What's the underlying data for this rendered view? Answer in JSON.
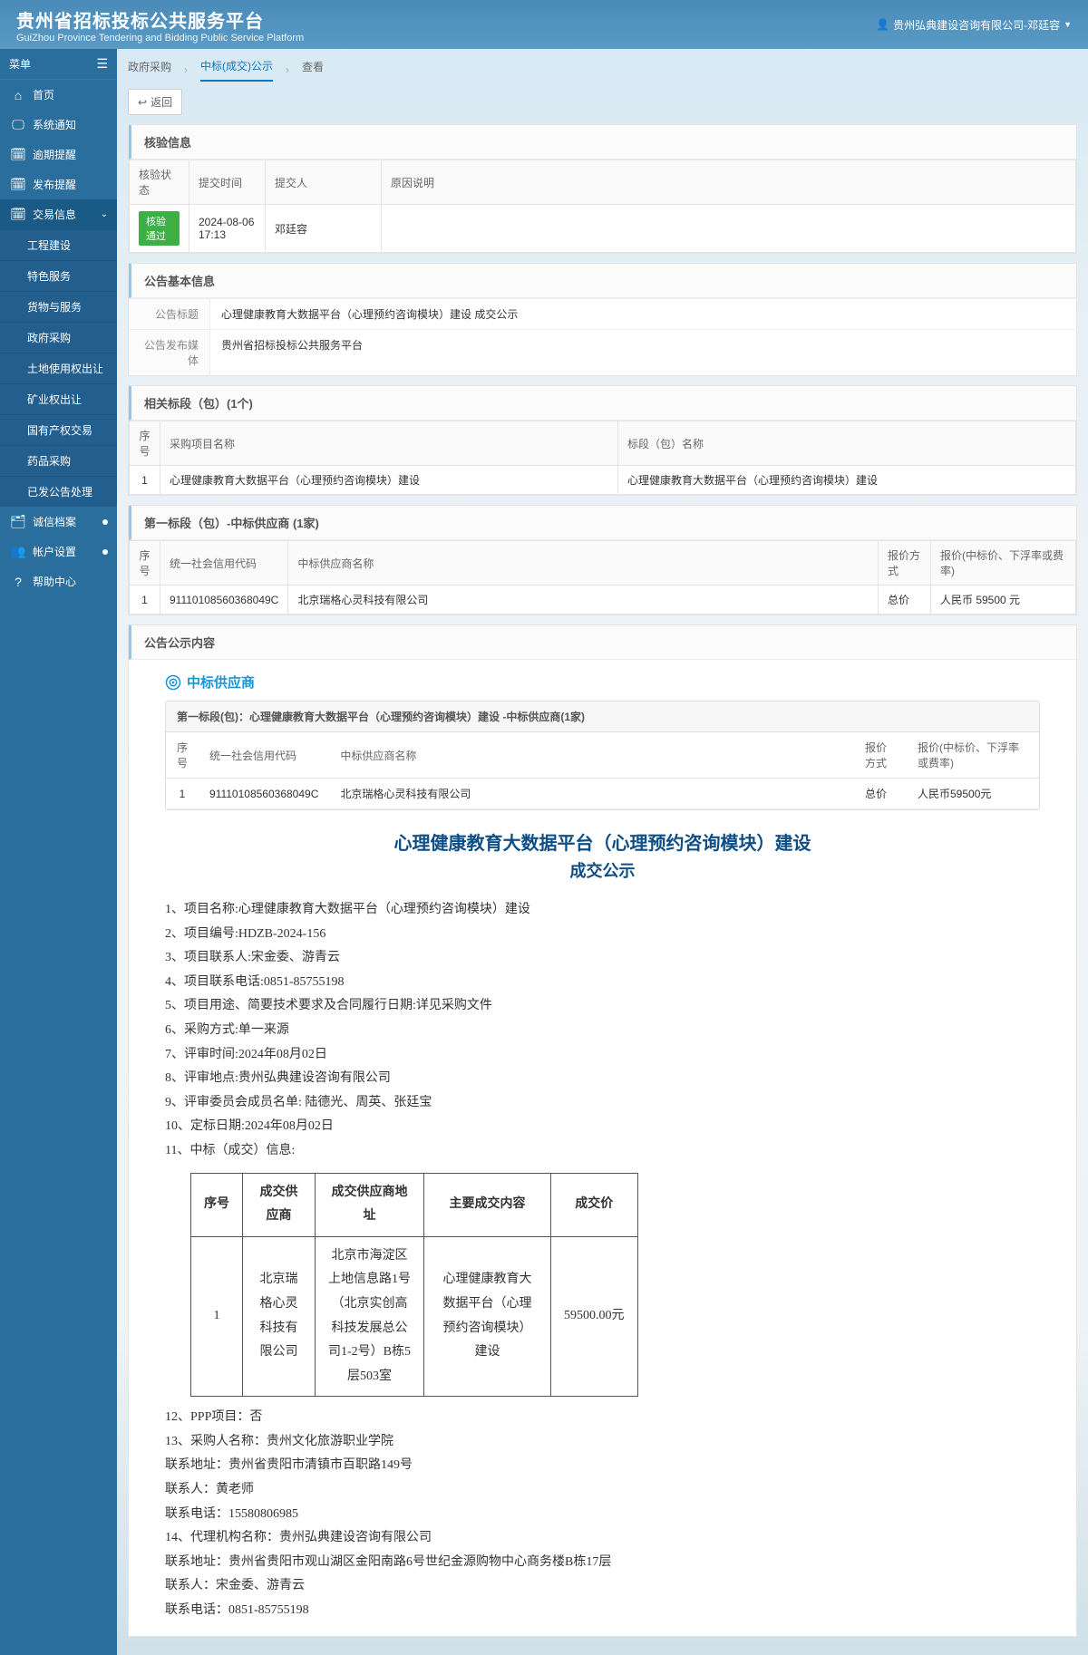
{
  "header": {
    "title_cn": "贵州省招标投标公共服务平台",
    "title_en": "GuiZhou Province Tendering and Bidding Public Service Platform",
    "user": "贵州弘典建设咨询有限公司-邓廷容"
  },
  "sidebar": {
    "label": "菜单",
    "items": [
      {
        "icon": "⌂",
        "label": "首页"
      },
      {
        "icon": "🖵",
        "label": "系统通知"
      },
      {
        "icon": "🗓",
        "label": "逾期提醒"
      },
      {
        "icon": "🗓",
        "label": "发布提醒"
      },
      {
        "icon": "🗓",
        "label": "交易信息",
        "active": true,
        "expandable": true
      },
      {
        "icon": "🗂",
        "label": "诚信档案",
        "indicator": true
      },
      {
        "icon": "👥",
        "label": "帐户设置",
        "indicator": true
      },
      {
        "icon": "?",
        "label": "帮助中心"
      }
    ],
    "sub_items": [
      "工程建设",
      "特色服务",
      "货物与服务",
      "政府采购",
      "土地使用权出让",
      "矿业权出让",
      "国有产权交易",
      "药品采购",
      "已发公告处理"
    ]
  },
  "breadcrumb": {
    "a": "政府采购",
    "b": "中标(成交)公示",
    "c": "查看"
  },
  "back_btn": "返回",
  "panels": {
    "check": {
      "title": "核验信息",
      "headers": [
        "核验状态",
        "提交时间",
        "提交人",
        "原因说明"
      ],
      "row": {
        "status": "核验通过",
        "time": "2024-08-06 17:13",
        "person": "邓廷容",
        "reason": ""
      }
    },
    "basic": {
      "title": "公告基本信息",
      "labels": {
        "title": "公告标题",
        "media": "公告发布媒体"
      },
      "values": {
        "title": "心理健康教育大数据平台（心理预约咨询模块）建设 成交公示",
        "media": "贵州省招标投标公共服务平台"
      }
    },
    "bidsection": {
      "title": "相关标段（包）(1个)",
      "headers": [
        "序号",
        "采购项目名称",
        "标段（包）名称"
      ],
      "row": {
        "seq": "1",
        "proj": "心理健康教育大数据平台（心理预约咨询模块）建设",
        "pkg": "心理健康教育大数据平台（心理预约咨询模块）建设"
      }
    },
    "winner": {
      "title": "第一标段（包）-中标供应商 (1家)",
      "headers": [
        "序号",
        "统一社会信用代码",
        "中标供应商名称",
        "报价方式",
        "报价(中标价、下浮率或费率)"
      ],
      "row": {
        "seq": "1",
        "code": "91110108560368049C",
        "name": "北京瑞格心灵科技有限公司",
        "method": "总价",
        "price": "人民币 59500 元"
      }
    },
    "content": {
      "title": "公告公示内容"
    }
  },
  "content_block": {
    "zb_label": "中标供应商",
    "box_header": "第一标段(包)：心理健康教育大数据平台（心理预约咨询模块）建设 -中标供应商(1家)",
    "inner_headers": [
      "序号",
      "统一社会信用代码",
      "中标供应商名称",
      "报价方式",
      "报价(中标价、下浮率或费率)"
    ],
    "inner_row": {
      "seq": "1",
      "code": "91110108560368049C",
      "name": "北京瑞格心灵科技有限公司",
      "method": "总价",
      "price": "人民币59500元"
    },
    "doc_title": "心理健康教育大数据平台（心理预约咨询模块）建设",
    "doc_subtitle": "成交公示",
    "lines": [
      "1、项目名称:心理健康教育大数据平台（心理预约咨询模块）建设",
      "2、项目编号:HDZB-2024-156",
      "3、项目联系人:宋金委、游青云",
      "4、项目联系电话:0851-85755198",
      "5、项目用途、简要技术要求及合同履行日期:详见采购文件",
      "6、采购方式:单一来源",
      "7、评审时间:2024年08月02日",
      "8、评审地点:贵州弘典建设咨询有限公司",
      "9、评审委员会成员名单: 陆德光、周英、张廷宝",
      "10、定标日期:2024年08月02日",
      "11、中标（成交）信息:"
    ],
    "deal_headers": [
      "序号",
      "成交供应商",
      "成交供应商地址",
      "主要成交内容",
      "成交价"
    ],
    "deal_row": {
      "seq": "1",
      "supplier": "北京瑞格心灵科技有限公司",
      "addr": "北京市海淀区上地信息路1号（北京实创高科技发展总公司1-2号）B栋5层503室",
      "content": "心理健康教育大数据平台（心理预约咨询模块）建设",
      "price": "59500.00元"
    },
    "lines2": [
      "12、PPP项目：否",
      "13、采购人名称：贵州文化旅游职业学院",
      "联系地址：贵州省贵阳市清镇市百职路149号",
      "联系人：黄老师",
      "联系电话：15580806985",
      "14、代理机构名称：贵州弘典建设咨询有限公司",
      "联系地址：贵州省贵阳市观山湖区金阳南路6号世纪金源购物中心商务楼B栋17层",
      "联系人：宋金委、游青云",
      "联系电话：0851-85755198"
    ]
  }
}
